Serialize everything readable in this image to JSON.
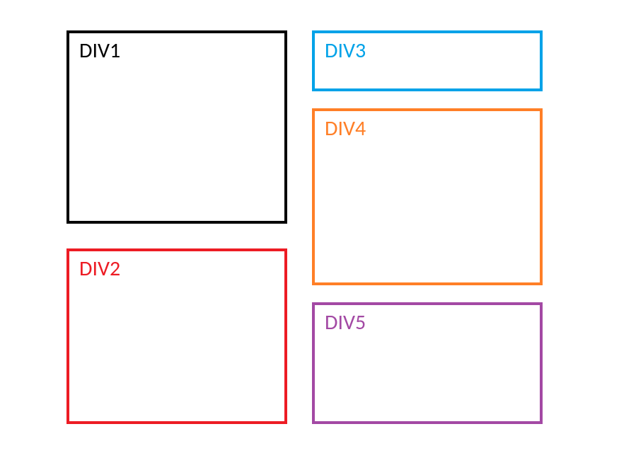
{
  "boxes": {
    "div1": {
      "label": "DIV1",
      "color": "#000000"
    },
    "div2": {
      "label": "DIV2",
      "color": "#ed1c24"
    },
    "div3": {
      "label": "DIV3",
      "color": "#00a2e8"
    },
    "div4": {
      "label": "DIV4",
      "color": "#ff7f27"
    },
    "div5": {
      "label": "DIV5",
      "color": "#a349a4"
    }
  }
}
